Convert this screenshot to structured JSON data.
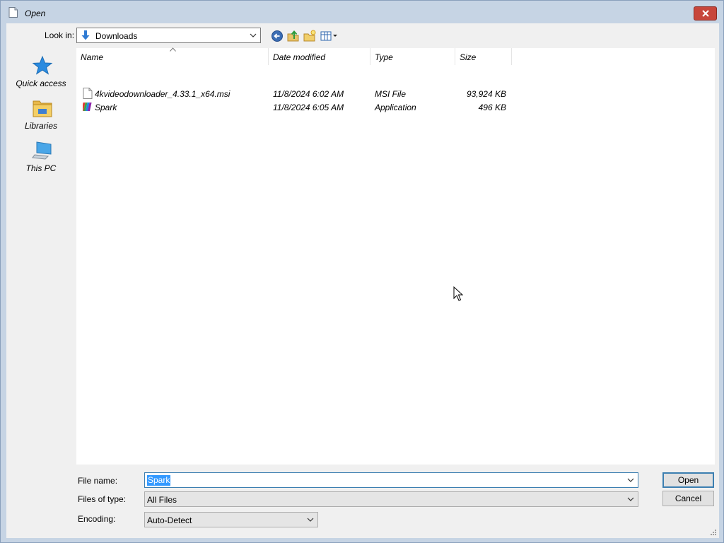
{
  "window": {
    "title": "Open"
  },
  "toolbar": {
    "look_in_label": "Look in:",
    "look_in_value": "Downloads",
    "buttons": [
      {
        "name": "back-icon"
      },
      {
        "name": "up-folder-icon"
      },
      {
        "name": "new-folder-icon"
      },
      {
        "name": "view-menu-icon"
      }
    ]
  },
  "places": [
    {
      "label": "Quick access",
      "icon": "star-icon"
    },
    {
      "label": "Libraries",
      "icon": "libraries-icon"
    },
    {
      "label": "This PC",
      "icon": "computer-icon"
    }
  ],
  "filelist": {
    "columns": [
      "Name",
      "Date modified",
      "Type",
      "Size"
    ],
    "rows": [
      {
        "name": "4kvideodownloader_4.33.1_x64.msi",
        "date": "11/8/2024 6:02 AM",
        "type": "MSI File",
        "size": "93,924 KB",
        "icon": "msi-file-icon"
      },
      {
        "name": "Spark",
        "date": "11/8/2024 6:05 AM",
        "type": "Application",
        "size": "496 KB",
        "icon": "application-icon"
      }
    ]
  },
  "form": {
    "file_name_label": "File name:",
    "file_name_value": "Spark",
    "file_type_label": "Files of type:",
    "file_type_value": "All Files",
    "encoding_label": "Encoding:",
    "encoding_value": "Auto-Detect",
    "open_label": "Open",
    "cancel_label": "Cancel"
  },
  "colors": {
    "title_bg": "#c6d4e4",
    "close_button": "#c7463b",
    "selection": "#3399ff",
    "focus_border": "#3c7fb1"
  }
}
